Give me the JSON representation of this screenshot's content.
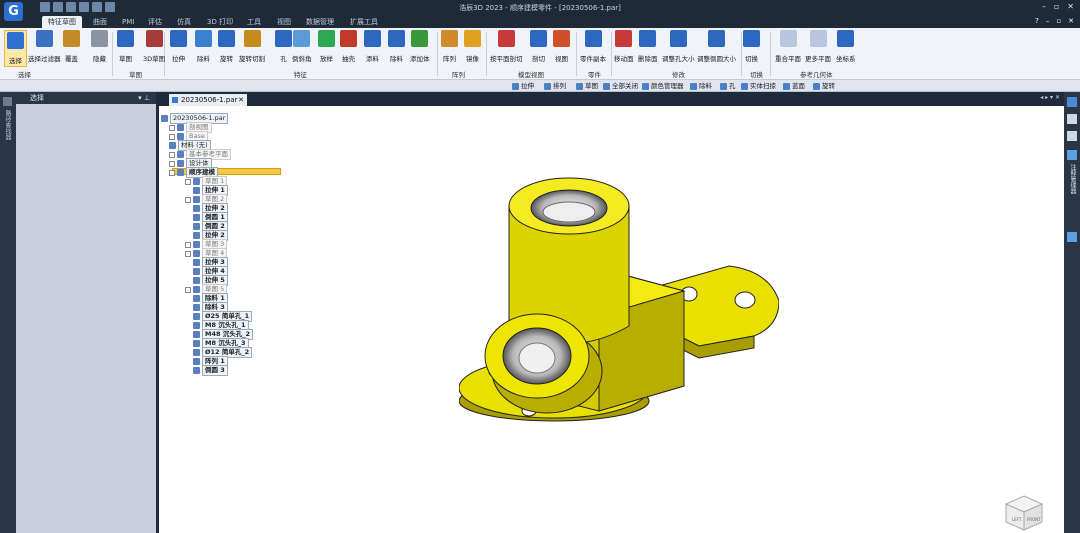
{
  "app": {
    "title": "浩辰3D 2023 - 顺序建模零件 - [20230506-1.par]",
    "logo_letter": "G"
  },
  "window_controls": {
    "minimize": "–",
    "restore": "▫",
    "close": "✕"
  },
  "help_controls": {
    "help": "?",
    "min": "–",
    "restore": "▫",
    "close": "✕"
  },
  "tabs": [
    "特征草图",
    "曲面",
    "PMI",
    "评估",
    "仿真",
    "3D 打印",
    "工具",
    "视图",
    "数据管理",
    "扩展工具"
  ],
  "active_tab": "特征草图",
  "ribbon": {
    "buttons": [
      {
        "name": "select",
        "label": "选择",
        "color": "#2f6fd0"
      },
      {
        "name": "selection-filter",
        "label": "选择过滤器",
        "color": "#3b70c2"
      },
      {
        "name": "overlay",
        "label": "覆盖",
        "color": "#c28a28"
      },
      {
        "name": "hide",
        "label": "隐藏",
        "color": "#8a93a0"
      },
      {
        "name": "sketch",
        "label": "草图",
        "color": "#2d67c0"
      },
      {
        "name": "3d-sketch",
        "label": "3D草图",
        "color": "#a83a3a"
      },
      {
        "name": "extrude",
        "label": "拉伸",
        "color": "#2d67c0"
      },
      {
        "name": "cut",
        "label": "除料",
        "color": "#3a80d0"
      },
      {
        "name": "revolve",
        "label": "旋转",
        "color": "#2d67c0"
      },
      {
        "name": "revolve-cut",
        "label": "旋转切割",
        "color": "#c48a1c"
      },
      {
        "name": "hole",
        "label": "孔",
        "color": "#2d67c0"
      },
      {
        "name": "chamfer",
        "label": "倒斜角",
        "color": "#5a9ad8"
      },
      {
        "name": "loft",
        "label": "放样",
        "color": "#2ca854"
      },
      {
        "name": "thin-wall",
        "label": "抽壳",
        "color": "#c0392b"
      },
      {
        "name": "sweep",
        "label": "添料",
        "color": "#2d67c0"
      },
      {
        "name": "remove",
        "label": "除料",
        "color": "#2d67c0"
      },
      {
        "name": "add-body",
        "label": "添加体",
        "color": "#3a9a3a"
      },
      {
        "name": "pattern",
        "label": "阵列",
        "color": "#d08a2a"
      },
      {
        "name": "mirror",
        "label": "镜像",
        "color": "#e0a020"
      },
      {
        "name": "cross-section",
        "label": "按平面剖切",
        "color": "#c83a3a"
      },
      {
        "name": "section",
        "label": "剖切",
        "color": "#2d67c0"
      },
      {
        "name": "view",
        "label": "视图",
        "color": "#d0502a"
      },
      {
        "name": "part-copy",
        "label": "零件副本",
        "color": "#2d67c0"
      },
      {
        "name": "move-face",
        "label": "移动面",
        "color": "#c83a3a"
      },
      {
        "name": "delete-face",
        "label": "删除面",
        "color": "#2d67c0"
      },
      {
        "name": "resize-hole",
        "label": "调整孔大小",
        "color": "#2d67c0"
      },
      {
        "name": "resize-fillet",
        "label": "调整倒圆大小",
        "color": "#2d67c0"
      },
      {
        "name": "cut-ops",
        "label": "切换",
        "color": "#2d67c0"
      },
      {
        "name": "coincident-plane",
        "label": "重合平面",
        "color": "#b8c6e0"
      },
      {
        "name": "more-planes",
        "label": "更多平面",
        "color": "#b8c6e0"
      },
      {
        "name": "coord-system",
        "label": "坐标系",
        "color": "#2d67c0"
      }
    ],
    "groups": [
      "选择",
      "草图",
      "特征",
      "阵列",
      "模型视图",
      "零件",
      "修改",
      "切换",
      "参考几何体"
    ]
  },
  "command_bar": [
    "拉伸",
    "排列",
    "草图",
    "全部关闭",
    "颜色管理器",
    "除料",
    "孔",
    "实体扫掠",
    "蓝面",
    "旋转"
  ],
  "left_panel": {
    "title": "选择",
    "side_label": "路径查找器"
  },
  "right_strip": {
    "label": "注释管理器"
  },
  "doc_tab": {
    "label": "20230506-1.par",
    "close": "✕"
  },
  "tree": [
    {
      "label": "20230506-1.par",
      "style": "normal"
    },
    {
      "label": "剖视图",
      "style": "grey"
    },
    {
      "label": "Base",
      "style": "grey"
    },
    {
      "label": "材料 (无)",
      "style": "normal"
    },
    {
      "label": "基本参考平面",
      "style": "grey"
    },
    {
      "label": "设计体",
      "style": "normal"
    },
    {
      "label": "顺序建模",
      "style": "bold"
    },
    {
      "label": "草图 1",
      "style": "grey"
    },
    {
      "label": "拉伸 1",
      "style": "bold"
    },
    {
      "label": "草图 2",
      "style": "grey"
    },
    {
      "label": "拉伸 2",
      "style": "bold"
    },
    {
      "label": "倒圆 1",
      "style": "bold"
    },
    {
      "label": "倒圆 2",
      "style": "bold"
    },
    {
      "label": "拉伸 2",
      "style": "bold"
    },
    {
      "label": "草图 3",
      "style": "grey"
    },
    {
      "label": "草图 4",
      "style": "grey"
    },
    {
      "label": "拉伸 3",
      "style": "bold"
    },
    {
      "label": "拉伸 4",
      "style": "bold"
    },
    {
      "label": "拉伸 5",
      "style": "bold"
    },
    {
      "label": "草图 5",
      "style": "grey"
    },
    {
      "label": "除料 1",
      "style": "bold"
    },
    {
      "label": "除料 3",
      "style": "bold"
    },
    {
      "label": "Ø25 简单孔_1",
      "style": "bold"
    },
    {
      "label": "M8 沉头孔_1",
      "style": "bold"
    },
    {
      "label": "M48 沉头孔_2",
      "style": "bold"
    },
    {
      "label": "M8 沉头孔_3",
      "style": "bold"
    },
    {
      "label": "Ø12 简单孔_2",
      "style": "bold"
    },
    {
      "label": "阵列 1",
      "style": "bold"
    },
    {
      "label": "倒圆 3",
      "style": "bold"
    }
  ],
  "viewcube": {
    "left": "LEFT",
    "front": "FRONT"
  },
  "colors": {
    "part": "#e8e000",
    "part_shadow": "#a99d00",
    "background": "#ffffff"
  }
}
